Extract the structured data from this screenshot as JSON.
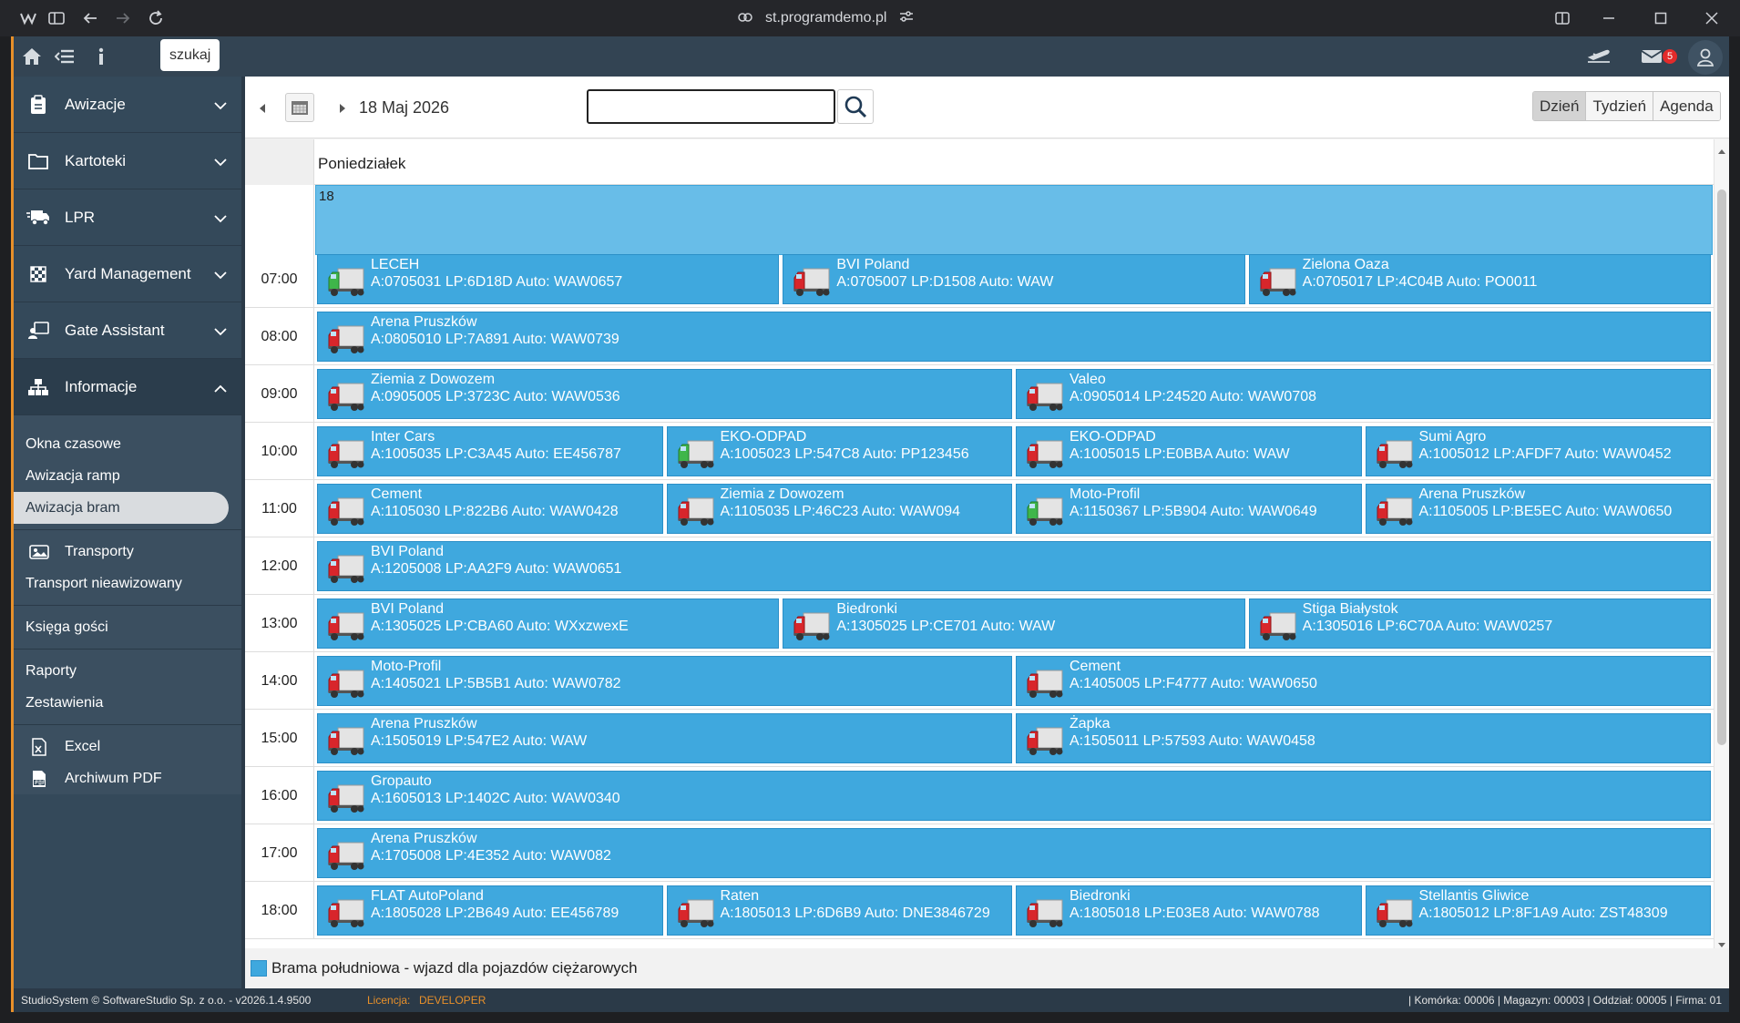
{
  "browser": {
    "url": "st.programdemo.pl"
  },
  "topbar": {
    "search_label": "szukaj",
    "mail_count": "5"
  },
  "sidebar": {
    "menus": [
      {
        "label": "Awizacje"
      },
      {
        "label": "Kartoteki"
      },
      {
        "label": "LPR"
      },
      {
        "label": "Yard Management"
      },
      {
        "label": "Gate Assistant"
      },
      {
        "label": "Informacje"
      }
    ],
    "submenu": [
      {
        "label": "Okna czasowe"
      },
      {
        "label": "Awizacja ramp"
      },
      {
        "label": "Awizacja bram"
      },
      {
        "label": "Transporty"
      },
      {
        "label": "Transport nieawizowany"
      },
      {
        "label": "Księga gości"
      },
      {
        "label": "Raporty"
      },
      {
        "label": "Zestawienia"
      },
      {
        "label": "Excel"
      },
      {
        "label": "Archiwum PDF"
      }
    ],
    "active_item": "Awizacja bram"
  },
  "toolbar": {
    "date": "18 Maj 2026",
    "search_value": "",
    "views": [
      "Dzień",
      "Tydzień",
      "Agenda"
    ],
    "active_view": "Dzień"
  },
  "calendar": {
    "day_name": "Poniedziałek",
    "day_number": "18",
    "rows": [
      {
        "hour": "07:00",
        "events": [
          {
            "name": "LECEH",
            "info": "A:0705031 LP:6D18D Auto: WAW0657",
            "truck": "green"
          },
          {
            "name": "BVI Poland",
            "info": "A:0705007 LP:D1508 Auto: WAW",
            "truck": "red"
          },
          {
            "name": "Zielona Oaza",
            "info": "A:0705017 LP:4C04B Auto: PO0011",
            "truck": "red"
          }
        ]
      },
      {
        "hour": "08:00",
        "events": [
          {
            "name": "Arena Pruszków",
            "info": "A:0805010 LP:7A891 Auto: WAW0739",
            "truck": "red"
          }
        ]
      },
      {
        "hour": "09:00",
        "events": [
          {
            "name": "Ziemia z Dowozem",
            "info": "A:0905005 LP:3723C Auto: WAW0536",
            "truck": "red"
          },
          {
            "name": "Valeo",
            "info": "A:0905014 LP:24520 Auto: WAW0708",
            "truck": "red"
          }
        ]
      },
      {
        "hour": "10:00",
        "events": [
          {
            "name": "Inter Cars",
            "info": "A:1005035 LP:C3A45 Auto: EE456787",
            "truck": "red"
          },
          {
            "name": "EKO-ODPAD",
            "info": "A:1005023 LP:547C8 Auto: PP123456",
            "truck": "green"
          },
          {
            "name": "EKO-ODPAD",
            "info": "A:1005015 LP:E0BBA Auto: WAW",
            "truck": "red"
          },
          {
            "name": "Sumi Agro",
            "info": "A:1005012 LP:AFDF7 Auto: WAW0452",
            "truck": "red"
          }
        ]
      },
      {
        "hour": "11:00",
        "events": [
          {
            "name": "Cement",
            "info": "A:1105030 LP:822B6 Auto: WAW0428",
            "truck": "red"
          },
          {
            "name": "Ziemia z Dowozem",
            "info": "A:1105035 LP:46C23 Auto: WAW094",
            "truck": "red"
          },
          {
            "name": "Moto-Profil",
            "info": "A:1150367 LP:5B904 Auto: WAW0649",
            "truck": "green"
          },
          {
            "name": "Arena Pruszków",
            "info": "A:1105005 LP:BE5EC Auto: WAW0650",
            "truck": "red"
          }
        ]
      },
      {
        "hour": "12:00",
        "events": [
          {
            "name": "BVI Poland",
            "info": "A:1205008 LP:AA2F9 Auto: WAW0651",
            "truck": "red"
          }
        ]
      },
      {
        "hour": "13:00",
        "events": [
          {
            "name": "BVI Poland",
            "info": "A:1305025 LP:CBA60 Auto: WXxzwexE",
            "truck": "red"
          },
          {
            "name": "Biedronki",
            "info": "A:1305025 LP:CE701 Auto: WAW",
            "truck": "red"
          },
          {
            "name": "Stiga Białystok",
            "info": "A:1305016 LP:6C70A Auto: WAW0257",
            "truck": "red"
          }
        ]
      },
      {
        "hour": "14:00",
        "events": [
          {
            "name": "Moto-Profil",
            "info": "A:1405021 LP:5B5B1 Auto: WAW0782",
            "truck": "red"
          },
          {
            "name": "Cement",
            "info": "A:1405005 LP:F4777 Auto: WAW0650",
            "truck": "red"
          }
        ]
      },
      {
        "hour": "15:00",
        "events": [
          {
            "name": "Arena Pruszków",
            "info": "A:1505019 LP:547E2 Auto: WAW",
            "truck": "red"
          },
          {
            "name": "Żapka",
            "info": "A:1505011 LP:57593 Auto: WAW0458",
            "truck": "red"
          }
        ]
      },
      {
        "hour": "16:00",
        "events": [
          {
            "name": "Gropauto",
            "info": "A:1605013 LP:1402C Auto: WAW0340",
            "truck": "red"
          }
        ]
      },
      {
        "hour": "17:00",
        "events": [
          {
            "name": "Arena Pruszków",
            "info": "A:1705008 LP:4E352 Auto: WAW082",
            "truck": "red"
          }
        ]
      },
      {
        "hour": "18:00",
        "events": [
          {
            "name": "FLAT AutoPoland",
            "info": "A:1805028 LP:2B649 Auto: EE456789",
            "truck": "red"
          },
          {
            "name": "Raten",
            "info": "A:1805013 LP:6D6B9 Auto: DNE3846729",
            "truck": "red"
          },
          {
            "name": "Biedronki",
            "info": "A:1805018 LP:E03E8 Auto: WAW0788",
            "truck": "red"
          },
          {
            "name": "Stellantis Gliwice",
            "info": "A:1805012 LP:8F1A9 Auto: ZST48309",
            "truck": "red"
          }
        ]
      }
    ]
  },
  "legend": {
    "label": "Brama południowa - wjazd dla pojazdów ciężarowych",
    "color": "#3fa8de"
  },
  "status": {
    "copyright": "StudioSystem © SoftwareStudio Sp. z o.o. - v2026.1.4.9500",
    "license_label": "Licencja:",
    "license_value": "DEVELOPER",
    "info": "| Komórka: 00006 | Magazyn: 00003 | Oddział: 00005 | Firma: 01"
  },
  "colors": {
    "accent": "#e8902a",
    "event": "#3fa8de",
    "sidebar": "#34495a"
  }
}
